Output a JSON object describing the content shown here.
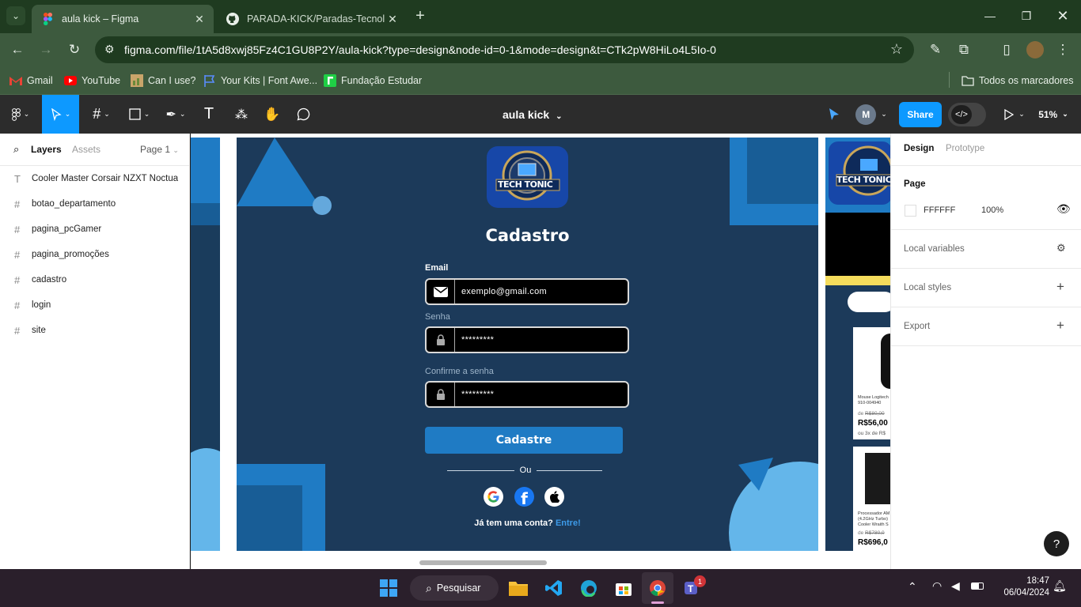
{
  "browser": {
    "tabs": [
      {
        "title": "aula kick – Figma",
        "active": true,
        "favicon": "figma-icon"
      },
      {
        "title": "PARADA-KICK/Paradas-Tecnolo",
        "active": false,
        "favicon": "github-icon"
      }
    ],
    "url": "figma.com/file/1tA5d8xwj85Fz4C1GU8P2Y/aula-kick?type=design&node-id=0-1&mode=design&t=CTk2pW8HiLo4L5Io-0",
    "bookmarks": [
      {
        "label": "Gmail",
        "icon": "gmail-icon"
      },
      {
        "label": "YouTube",
        "icon": "youtube-icon"
      },
      {
        "label": "Can I use?",
        "icon": "caniuse-icon"
      },
      {
        "label": "Your Kits | Font Awe...",
        "icon": "flag-icon"
      },
      {
        "label": "Fundação Estudar",
        "icon": "fundacao-icon"
      }
    ],
    "all_bookmarks": "Todos os marcadores"
  },
  "figma": {
    "file_title": "aula kick",
    "share_label": "Share",
    "avatar_letter": "M",
    "zoom": "51%",
    "left_tabs": {
      "layers": "Layers",
      "assets": "Assets",
      "page": "Page 1"
    },
    "layers": [
      {
        "type": "text",
        "name": "Cooler Master Corsair NZXT Noctua"
      },
      {
        "type": "frame",
        "name": "botao_departamento"
      },
      {
        "type": "frame",
        "name": "pagina_pcGamer"
      },
      {
        "type": "frame",
        "name": "pagina_promoções"
      },
      {
        "type": "frame",
        "name": "cadastro"
      },
      {
        "type": "frame",
        "name": "login"
      },
      {
        "type": "frame",
        "name": "site"
      }
    ],
    "right_tabs": {
      "design": "Design",
      "prototype": "Prototype"
    },
    "page_section": {
      "title": "Page",
      "color": "FFFFFF",
      "opacity": "100%"
    },
    "sections": {
      "local_variables": "Local variables",
      "local_styles": "Local styles",
      "export": "Export"
    },
    "help": "?"
  },
  "design": {
    "logo_text": "TECH TONIC",
    "title": "Cadastro",
    "email_label": "Email",
    "email_value": "exemplo@gmail.com",
    "senha_label": "Senha",
    "senha_value": "*********",
    "confirm_label": "Confirme a senha",
    "confirm_value": "*********",
    "submit": "Cadastre",
    "or": "Ou",
    "have_account": "Já tem uma conta?",
    "login_link": "Entre!",
    "colors": {
      "frame_bg": "#1c3a5a",
      "accent": "#1f7bc4",
      "light_blue": "#64b6ea",
      "link": "#3d9be9"
    }
  },
  "side_frame": {
    "product1": {
      "name": "Mouse Logitech",
      "sku": "910-004940",
      "old_prefix": "de",
      "old_price": "R$80,00",
      "price": "R$56,00",
      "install": "ou 3x de R$"
    },
    "product2": {
      "name": "Processador AM",
      "spec": "(4.2GHz Turbo)",
      "cooler": "Cooler Wraith S",
      "old_prefix": "de",
      "old_price": "R$780,0",
      "price": "R$696,0"
    }
  },
  "taskbar": {
    "search": "Pesquisar",
    "time": "18:47",
    "date": "06/04/2024",
    "teams_badge": "1"
  }
}
